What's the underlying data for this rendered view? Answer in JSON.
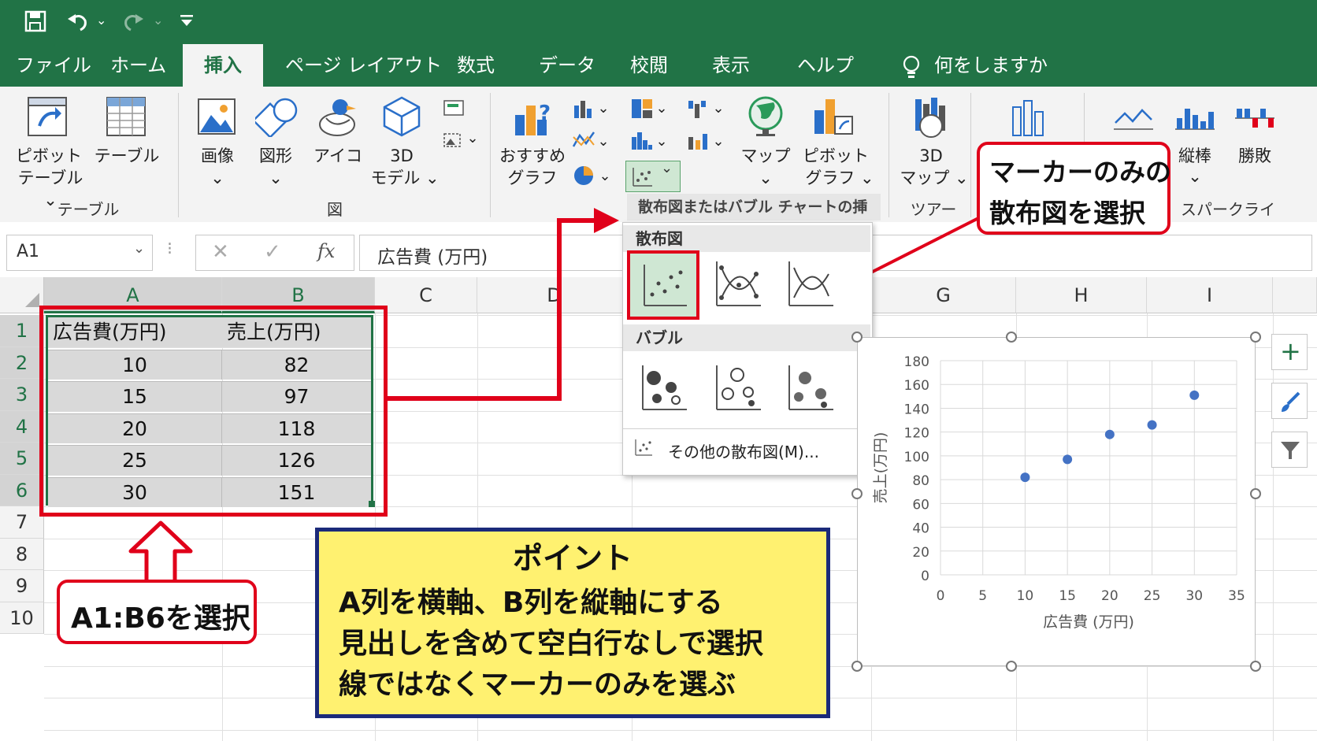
{
  "colors": {
    "excel_green": "#217346",
    "ribbon_bg": "#f3f3f3",
    "highlight_red": "#e0001a",
    "point_yellow": "#fff170",
    "point_border": "#1b2a7a",
    "marker_blue": "#4472c4"
  },
  "quick_access": {
    "save_icon": "save-icon",
    "undo_icon": "undo-icon",
    "redo_icon": "redo-icon",
    "customize_icon": "customize-icon"
  },
  "tabs": [
    "ファイル",
    "ホーム",
    "挿入",
    "ページ レイアウト",
    "数式",
    "データ",
    "校閲",
    "表示",
    "ヘルプ"
  ],
  "active_tab": "挿入",
  "tell_me": "何をしますか",
  "ribbon": {
    "pivot_table_l1": "ピボット",
    "pivot_table_l2": "テーブル ⌄",
    "table": "テーブル",
    "group_table": "テーブル",
    "picture": "画像",
    "shapes": "図形",
    "icons": "アイコ",
    "model_l1": "3D",
    "model_l2": "モデル ⌄",
    "group_illust": "図",
    "recommended_l1": "おすすめ",
    "recommended_l2": "グラフ",
    "map": "マップ",
    "pivot_chart_l1": "ピボット",
    "pivot_chart_l2": "グラフ ⌄",
    "map3d_l1": "3D",
    "map3d_l2": "マップ ⌄",
    "group_tour": "ツアー",
    "sparkline_column": "縦棒",
    "sparkline_winloss": "勝敗",
    "group_sparkline": "スパークライン",
    "tooltip": "散布図またはバブル チャートの挿入"
  },
  "formula_bar": {
    "name_box": "A1",
    "content": "広告費 (万円)",
    "fx": "fx"
  },
  "grid": {
    "columns": [
      "A",
      "B",
      "C",
      "D",
      "G",
      "H",
      "I"
    ],
    "rows": [
      "1",
      "2",
      "3",
      "4",
      "5",
      "6",
      "7",
      "8",
      "9",
      "10"
    ],
    "headers": [
      "広告費(万円)",
      "売上(万円)"
    ],
    "data": [
      [
        "10",
        "82"
      ],
      [
        "15",
        "97"
      ],
      [
        "20",
        "118"
      ],
      [
        "25",
        "126"
      ],
      [
        "30",
        "151"
      ]
    ]
  },
  "dropdown": {
    "section_scatter": "散布図",
    "section_bubble": "バブル",
    "more": "その他の散布図(M)..."
  },
  "callouts": {
    "marker_only_l1": "マーカーのみの",
    "marker_only_l2": "散布図を選択",
    "select_range": "A1:B6を選択"
  },
  "point": {
    "title": "ポイント",
    "lines": [
      "A列を横軸、B列を縦軸にする",
      "見出しを含めて空白行なしで選択",
      "線ではなくマーカーのみを選ぶ"
    ]
  },
  "chart_data": {
    "type": "scatter",
    "x": [
      10,
      15,
      20,
      25,
      30
    ],
    "y": [
      82,
      97,
      118,
      126,
      151
    ],
    "xlabel": "広告費 (万円)",
    "ylabel": "売上(万円)",
    "xlim": [
      0,
      35
    ],
    "ylim": [
      0,
      180
    ],
    "xticks": [
      "0",
      "5",
      "10",
      "15",
      "20",
      "25",
      "30",
      "35"
    ],
    "yticks": [
      "0",
      "20",
      "40",
      "60",
      "80",
      "100",
      "120",
      "140",
      "160",
      "180"
    ],
    "grid": true,
    "marker_color": "#4472c4"
  }
}
